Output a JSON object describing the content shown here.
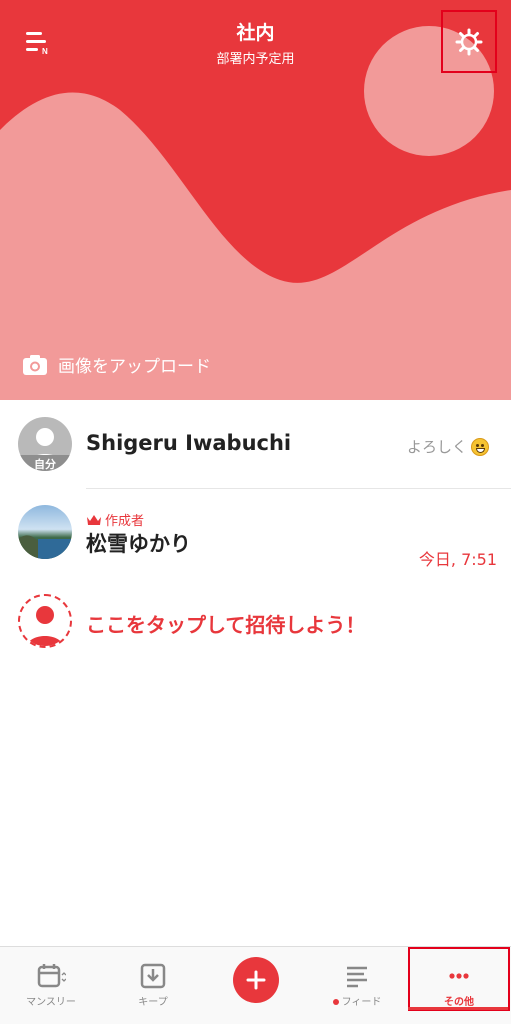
{
  "header": {
    "title": "社内",
    "subtitle": "部署内予定用",
    "upload_label": "画像をアップロード",
    "bg_color": "#e8373c",
    "shape_color": "#f29a99"
  },
  "members": [
    {
      "name": "Shigeru Iwabuchi",
      "avatar_badge": "自分",
      "status": "よろしく"
    },
    {
      "name": "松雪ゆかり",
      "role": "作成者",
      "time": "今日, 7:51"
    }
  ],
  "invite": {
    "label": "ここをタップして招待しよう！"
  },
  "tabbar": {
    "tabs": [
      {
        "label": "マンスリー",
        "icon": "calendar-icon"
      },
      {
        "label": "キープ",
        "icon": "download-icon"
      },
      {
        "label": "",
        "icon": "plus-icon"
      },
      {
        "label": "フィード",
        "icon": "feed-icon"
      },
      {
        "label": "その他",
        "icon": "more-icon"
      }
    ]
  }
}
